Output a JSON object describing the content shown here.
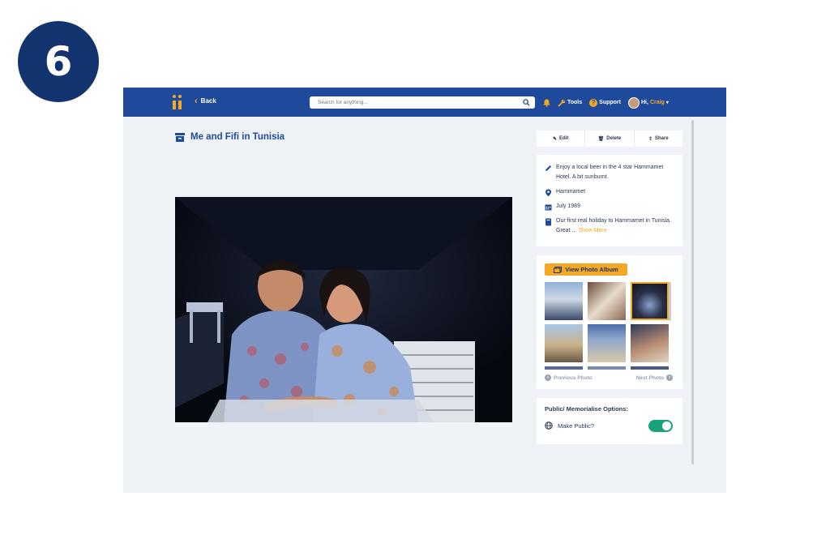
{
  "step": {
    "number": "6"
  },
  "header": {
    "back_label": "Back",
    "search_placeholder": "Search for anything...",
    "tools_label": "Tools",
    "support_label": "Support",
    "greeting": "Hi,",
    "user_name": "Craig",
    "colors": {
      "bar": "#1f4a9c",
      "accent": "#f7a823"
    }
  },
  "memory": {
    "title": "Me and Fifi in Tunisia",
    "actions": {
      "edit": "Edit",
      "delete": "Delete",
      "share": "Share"
    },
    "caption": "Enjoy a local beer in the 4 star Hammamet Hotel. A bit sunburnt.",
    "location": "Hammamet",
    "date": "July 1989",
    "story": "Our first real holiday to Hammamet in Tunisia. Great ...",
    "show_more": "Show More"
  },
  "album": {
    "button_label": "View Photo Album",
    "previous_label": "Previous Photo",
    "next_label": "Next Photo"
  },
  "public_options": {
    "title": "Public/ Memorialise Options:",
    "make_public_label": "Make Public?",
    "make_public": true,
    "toggle_color": "#1aa37a"
  },
  "icons": [
    "back-chevron-icon",
    "search-icon",
    "bell-icon",
    "wrench-icon",
    "question-icon",
    "pencil-icon",
    "trash-icon",
    "share-icon",
    "location-pin-icon",
    "calendar-icon",
    "book-icon",
    "album-icon",
    "globe-icon",
    "chevron-down-icon"
  ]
}
